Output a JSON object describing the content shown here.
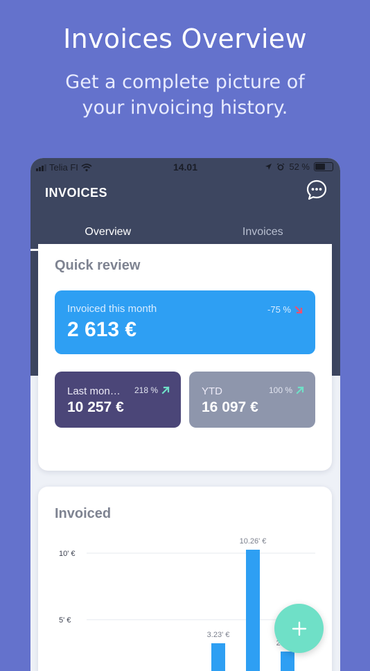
{
  "promo": {
    "title": "Invoices Overview",
    "subtitle": "Get a complete picture of your invoicing history."
  },
  "status_bar": {
    "carrier": "Telia FI",
    "time": "14.01",
    "battery": "52 %"
  },
  "header": {
    "title": "INVOICES",
    "chat_icon": "chat-bubble-icon"
  },
  "tabs": [
    {
      "label": "Overview",
      "active": true
    },
    {
      "label": "Invoices",
      "active": false
    }
  ],
  "quick_review": {
    "title": "Quick review",
    "this_month": {
      "label": "Invoiced this month",
      "value": "2 613 €",
      "change": "-75 %",
      "direction": "down",
      "arrow_color": "#f0506e"
    },
    "last_month": {
      "label": "Last mon…",
      "value": "10 257 €",
      "change": "218 %",
      "direction": "up",
      "arrow_color": "#6fe0c7"
    },
    "ytd": {
      "label": "YTD",
      "value": "16 097 €",
      "change": "100 %",
      "direction": "up",
      "arrow_color": "#6fe0c7"
    }
  },
  "invoiced": {
    "title": "Invoiced"
  },
  "chart_data": {
    "type": "bar",
    "title": "Invoiced",
    "y_tick_labels": [
      "10' €",
      "5' €"
    ],
    "y_ticks": [
      10,
      5
    ],
    "bars": [
      {
        "value": 3.23,
        "label": "3.23' €",
        "color": "#2e9ff3"
      },
      {
        "value": 10.26,
        "label": "10.26' €",
        "color": "#2e9ff3"
      },
      {
        "value": 2.61,
        "label": "2.61' €",
        "color": "#2e9ff3"
      }
    ],
    "grid": true
  },
  "fab": {
    "label": "+",
    "icon": "plus-icon"
  },
  "colors": {
    "background": "#6472cc",
    "header": "#3d4660",
    "primary_tile": "#2e9ff3",
    "last_month_tile": "#4b4678",
    "ytd_tile": "#8e96ac",
    "fab": "#6fe0c7"
  }
}
